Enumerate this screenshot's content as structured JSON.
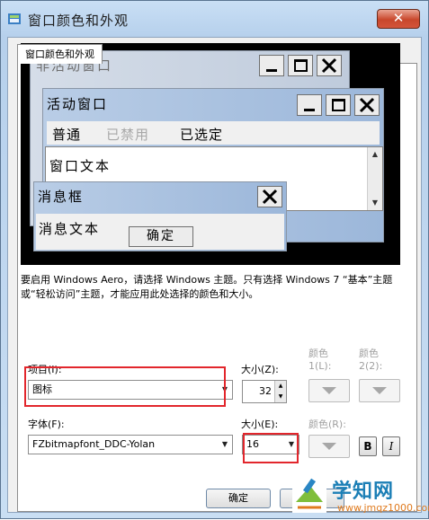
{
  "window": {
    "title": "窗口颜色和外观",
    "close_glyph": "✕"
  },
  "tab": {
    "label": "窗口颜色和外观"
  },
  "preview": {
    "inactive_title": "非活动窗口",
    "active_title": "活动窗口",
    "menu_items": [
      "普通",
      "已禁用",
      "已选定"
    ],
    "window_text": "窗口文本",
    "msgbox_title": "消息框",
    "msgbox_text": "消息文本",
    "ok_label": "确定"
  },
  "description": "要启用 Windows Aero，请选择 Windows 主题。只有选择 Windows 7 “基本”主题或“轻松访问”主题，才能应用此处选择的颜色和大小。",
  "item": {
    "label": "项目(I):",
    "value": "图标"
  },
  "size1": {
    "label": "大小(Z):",
    "value": "32"
  },
  "color1": {
    "label_line1": "颜色",
    "label_line2": "1(L):"
  },
  "color2": {
    "label_line1": "颜色",
    "label_line2": "2(2):"
  },
  "font": {
    "label": "字体(F):",
    "value": "FZbitmapfont_DDC-Yolan"
  },
  "size2": {
    "label": "大小(E):",
    "value": "16"
  },
  "color_r": {
    "label": "颜色(R):"
  },
  "format": {
    "bold": "B",
    "italic": "I"
  },
  "buttons": {
    "ok": "确定"
  },
  "watermark": {
    "brand": "学知网",
    "url": "www.jmqz1000.com"
  },
  "colors": {
    "highlight": "#e2262c",
    "preview_bg": "#000000",
    "close": "#c8472c"
  }
}
